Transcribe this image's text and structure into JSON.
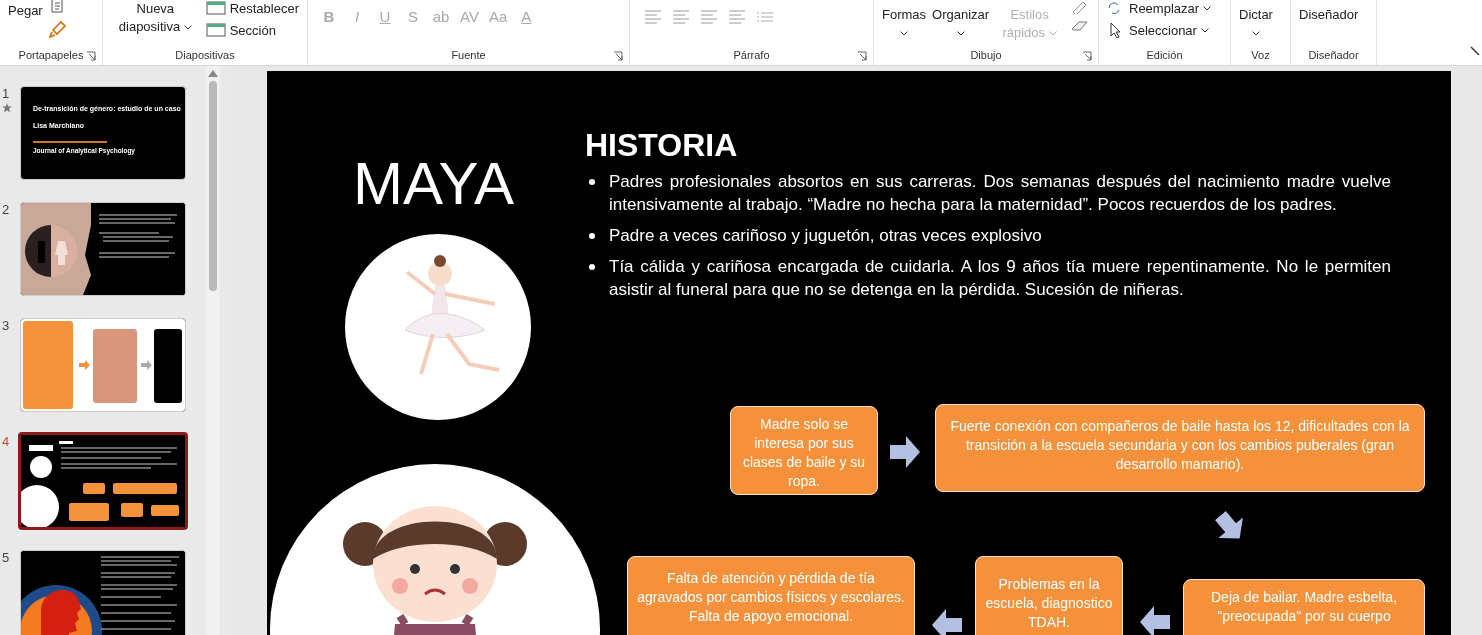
{
  "ribbon": {
    "groups": [
      {
        "kind": "clipboard",
        "name": "Portapapeles",
        "launcher": true,
        "paste": "Pegar"
      },
      {
        "kind": "slides",
        "name": "Diapositivas",
        "launcher": false,
        "new_slide": "Nueva diapositiva",
        "items": [
          "Restablecer",
          "Sección"
        ]
      },
      {
        "kind": "font",
        "name": "Fuente",
        "launcher": true,
        "buttons": [
          {
            "label": "B",
            "disabled": true
          },
          {
            "label": "I",
            "disabled": true
          },
          {
            "label": "U",
            "disabled": true
          },
          {
            "label": "S",
            "disabled": true
          },
          {
            "label": "ab",
            "disabled": true
          },
          {
            "label": "AV",
            "disabled": true
          },
          {
            "label": "Aa",
            "disabled": true
          },
          {
            "label": "A",
            "disabled": true
          }
        ]
      },
      {
        "kind": "paragraph",
        "name": "Párrafo",
        "launcher": true
      },
      {
        "kind": "drawing",
        "name": "Dibujo",
        "launcher": true,
        "items": [
          "Formas",
          "Organizar"
        ],
        "quick_styles": {
          "label": "Estilos rápidos",
          "disabled": true
        }
      },
      {
        "kind": "editing",
        "name": "Edición",
        "launcher": false,
        "items": [
          "Reemplazar",
          "Seleccionar"
        ]
      },
      {
        "kind": "voice",
        "name": "Voz",
        "launcher": false,
        "button": "Dictar"
      },
      {
        "kind": "designer",
        "name": "Diseñador",
        "launcher": false,
        "button": "Diseñador"
      }
    ]
  },
  "thumbnails": [
    {
      "number": "1",
      "kind": "title",
      "selected": false,
      "starred": true,
      "title": "De-transición de género: estudio de un caso",
      "author": "Lisa Marchiano",
      "journal": "Journal of Analytical Psychology"
    },
    {
      "number": "2",
      "kind": "photo",
      "selected": false,
      "starred": false
    },
    {
      "number": "3",
      "kind": "flow",
      "selected": false,
      "starred": false
    },
    {
      "number": "4",
      "kind": "current",
      "selected": true,
      "starred": false
    },
    {
      "number": "5",
      "kind": "profile",
      "selected": false,
      "starred": false
    }
  ],
  "slide": {
    "name": "MAYA",
    "heading": "HISTORIA",
    "bullets": [
      "Padres profesionales absortos en sus carreras. Dos semanas después del nacimiento madre vuelve intensivamente al trabajo. “Madre no hecha para la maternidad”. Pocos recuerdos de los padres.",
      "Padre a veces cariñoso y juguetón, otras veces explosivo",
      "Tía cálida y cariñosa encargada de cuidarla. A los 9 años tía muere repentinamente. No le permiten asistir al funeral para que no se detenga en la pérdida. Sucesión de niñeras."
    ],
    "flow_boxes": [
      "Madre solo se interesa por sus clases de baile y su ropa.",
      "Fuerte conexión con compañeros de baile hasta los 12, dificultades con la transición a la escuela secundaria y con los cambios puberales (gran desarrollo mamario).",
      "Falta de atención y pérdida de tía agravados por cambios físicos y escolares. Falta de apoyo emocional.",
      "Problemas en la escuela, diagnostico TDAH.",
      "Deja de bailar. Madre esbelta, \"preocupada\" por su cuerpo"
    ]
  }
}
